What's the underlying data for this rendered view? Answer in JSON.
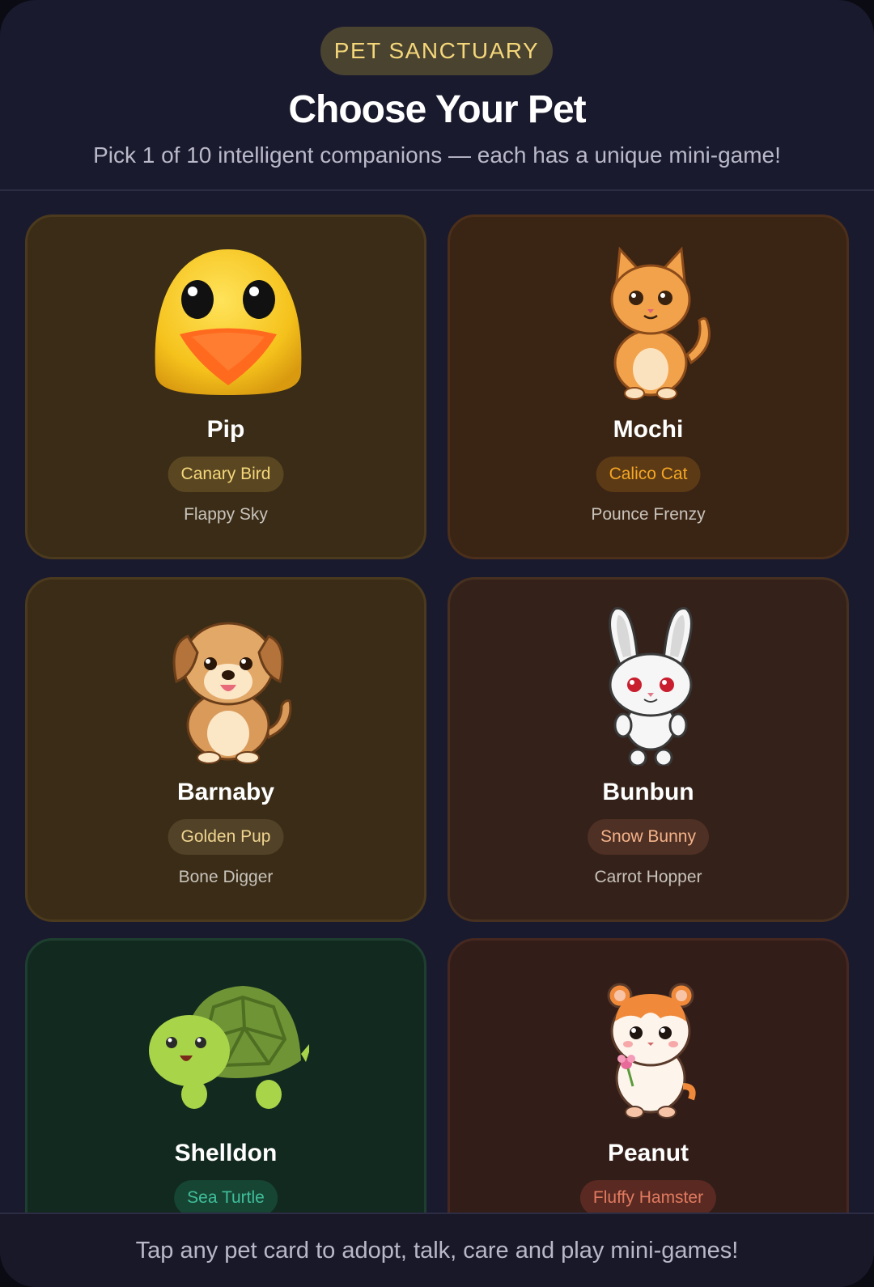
{
  "header": {
    "badge": "PET SANCTUARY",
    "title": "Choose Your Pet",
    "subtitle": "Pick 1 of 10 intelligent companions — each has a unique mini-game!"
  },
  "pets": [
    {
      "name": "Pip",
      "breed": "Canary Bird",
      "game": "Flappy Sky",
      "icon": "canary-bird-icon",
      "accent": "#f5d77a",
      "breed_bg": "#5a4722"
    },
    {
      "name": "Mochi",
      "breed": "Calico Cat",
      "game": "Pounce Frenzy",
      "icon": "cat-icon",
      "accent": "#f5a623",
      "breed_bg": "#5c3a16"
    },
    {
      "name": "Barnaby",
      "breed": "Golden Pup",
      "game": "Bone Digger",
      "icon": "puppy-icon",
      "accent": "#f0d590",
      "breed_bg": "#514228"
    },
    {
      "name": "Bunbun",
      "breed": "Snow Bunny",
      "game": "Carrot Hopper",
      "icon": "bunny-icon",
      "accent": "#f3b38a",
      "breed_bg": "#4f3024"
    },
    {
      "name": "Shelldon",
      "breed": "Sea Turtle",
      "game": "",
      "icon": "turtle-icon",
      "accent": "#3fbf9a",
      "breed_bg": "#174534"
    },
    {
      "name": "Peanut",
      "breed": "Fluffy Hamster",
      "game": "",
      "icon": "hamster-icon",
      "accent": "#e07a5f",
      "breed_bg": "#5a2a22"
    }
  ],
  "footer": {
    "hint": "Tap any pet card to adopt, talk, care and play mini-games!"
  }
}
